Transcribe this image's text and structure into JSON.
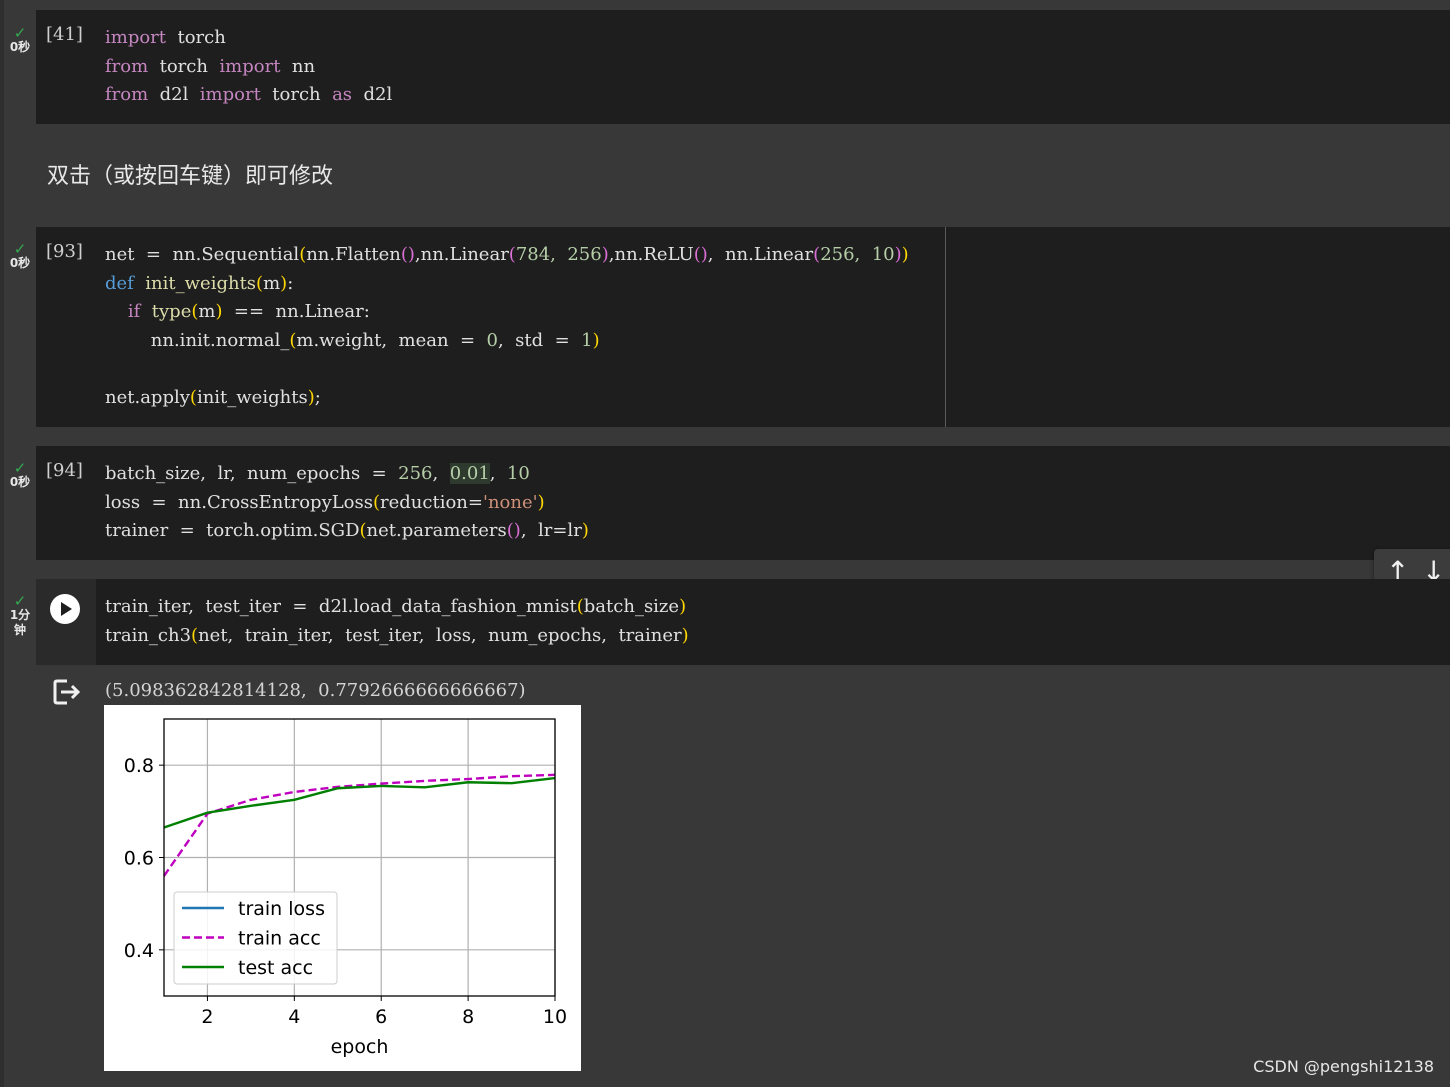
{
  "cells": [
    {
      "exec_count": "[41]",
      "status_time": "0秒",
      "code": [
        [
          [
            "import",
            "kw"
          ],
          [
            "  torch",
            ""
          ]
        ],
        [
          [
            "from",
            "kw"
          ],
          [
            "  torch  ",
            ""
          ],
          [
            "import",
            "kw"
          ],
          [
            "  nn",
            ""
          ]
        ],
        [
          [
            "from",
            "kw"
          ],
          [
            "  d2l  ",
            ""
          ],
          [
            "import",
            "kw"
          ],
          [
            "  torch  ",
            ""
          ],
          [
            "as",
            "kw"
          ],
          [
            "  d2l",
            ""
          ]
        ]
      ]
    },
    {
      "exec_count": "[93]",
      "status_time": "0秒",
      "code": [
        [
          [
            "net  =  nn.Sequential",
            ""
          ],
          [
            "(",
            "p1"
          ],
          [
            "nn.Flatten",
            ""
          ],
          [
            "()",
            "p2"
          ],
          [
            ",nn.Linear",
            ""
          ],
          [
            "(",
            "p2"
          ],
          [
            "784,  ",
            "num"
          ],
          [
            "256",
            "num"
          ],
          [
            ")",
            "p2"
          ],
          [
            ",nn.ReLU",
            ""
          ],
          [
            "()",
            "p2"
          ],
          [
            ",  nn.Linear",
            ""
          ],
          [
            "(",
            "p2"
          ],
          [
            "256,  ",
            "num"
          ],
          [
            "10",
            "num"
          ],
          [
            ")",
            "p2"
          ],
          [
            ")",
            "p1"
          ]
        ],
        [
          [
            "def",
            "kw2"
          ],
          [
            "  ",
            ""
          ],
          [
            "init_weights",
            "fn"
          ],
          [
            "(",
            "p1"
          ],
          [
            "m",
            ""
          ],
          [
            ")",
            "p1"
          ],
          [
            ":",
            ""
          ]
        ],
        [
          [
            "    ",
            ""
          ],
          [
            "if",
            "kw"
          ],
          [
            "  ",
            ""
          ],
          [
            "type",
            "fn"
          ],
          [
            "(",
            "p1"
          ],
          [
            "m",
            ""
          ],
          [
            ")",
            "p1"
          ],
          [
            "  ==  nn.Linear:",
            ""
          ]
        ],
        [
          [
            "        nn.init.normal_",
            ""
          ],
          [
            "(",
            "p1"
          ],
          [
            "m.weight,  mean  =  ",
            ""
          ],
          [
            "0",
            "num"
          ],
          [
            ",  std  =  ",
            ""
          ],
          [
            "1",
            "num"
          ],
          [
            ")",
            "p1"
          ]
        ],
        [
          [
            "",
            ""
          ]
        ],
        [
          [
            "net.apply",
            ""
          ],
          [
            "(",
            "p1"
          ],
          [
            "init_weights",
            ""
          ],
          [
            ")",
            "p1"
          ],
          [
            ";",
            ""
          ]
        ]
      ]
    },
    {
      "exec_count": "[94]",
      "status_time": "0秒",
      "code": [
        [
          [
            "batch_size,  lr,  num_epochs  =  ",
            ""
          ],
          [
            "256",
            "num"
          ],
          [
            ",  ",
            ""
          ],
          [
            "0.01",
            "num hl"
          ],
          [
            ",  ",
            ""
          ],
          [
            "10",
            "num"
          ]
        ],
        [
          [
            "loss  =  nn.CrossEntropyLoss",
            ""
          ],
          [
            "(",
            "p1"
          ],
          [
            "reduction=",
            ""
          ],
          [
            "'none'",
            "str"
          ],
          [
            ")",
            "p1"
          ]
        ],
        [
          [
            "trainer  =  torch.optim.SGD",
            ""
          ],
          [
            "(",
            "p1"
          ],
          [
            "net.parameters",
            ""
          ],
          [
            "()",
            "p2"
          ],
          [
            ",  lr=lr",
            ""
          ],
          [
            ")",
            "p1"
          ]
        ]
      ]
    },
    {
      "exec_count": "",
      "status_time": "1分钟",
      "code": [
        [
          [
            "train_iter,  test_iter  =  d2l.load_data_fashion_mnist",
            ""
          ],
          [
            "(",
            "p1"
          ],
          [
            "batch_size",
            ""
          ],
          [
            ")",
            "p1"
          ]
        ],
        [
          [
            "train_ch3",
            ""
          ],
          [
            "(",
            "p1"
          ],
          [
            "net,  train_iter,  test_iter,  loss,  num_epochs,  trainer",
            ""
          ],
          [
            ")",
            "p1"
          ]
        ]
      ]
    }
  ],
  "markdown_cell_text": "双击（或按回车键）即可修改",
  "output_text": "(5.098362842814128,  0.7792666666666667)",
  "watermark": "CSDN @pengshi12138",
  "status_time_last_line1": "1分",
  "status_time_last_line2": "钟",
  "nav_toolbar": {
    "up_icon": "arrow-up-icon",
    "down_icon": "arrow-down-icon"
  },
  "chart_data": {
    "type": "line",
    "xlabel": "epoch",
    "ylabel": "",
    "xlim": [
      1,
      10
    ],
    "ylim": [
      0.3,
      0.9
    ],
    "xticks": [
      2,
      4,
      6,
      8,
      10
    ],
    "yticks": [
      0.4,
      0.6,
      0.8
    ],
    "grid": true,
    "legend_position": "lower-left",
    "x": [
      1,
      2,
      3,
      4,
      5,
      6,
      7,
      8,
      9,
      10
    ],
    "series": [
      {
        "name": "train loss",
        "color": "#1f77b4",
        "style": "solid",
        "values": []
      },
      {
        "name": "train acc",
        "color": "#bf00bf",
        "style": "dashed",
        "values": [
          0.56,
          0.695,
          0.725,
          0.742,
          0.753,
          0.76,
          0.766,
          0.77,
          0.776,
          0.779
        ]
      },
      {
        "name": "test acc",
        "color": "#008000",
        "style": "solid",
        "values": [
          0.665,
          0.697,
          0.712,
          0.725,
          0.75,
          0.755,
          0.752,
          0.763,
          0.761,
          0.772
        ]
      }
    ]
  }
}
